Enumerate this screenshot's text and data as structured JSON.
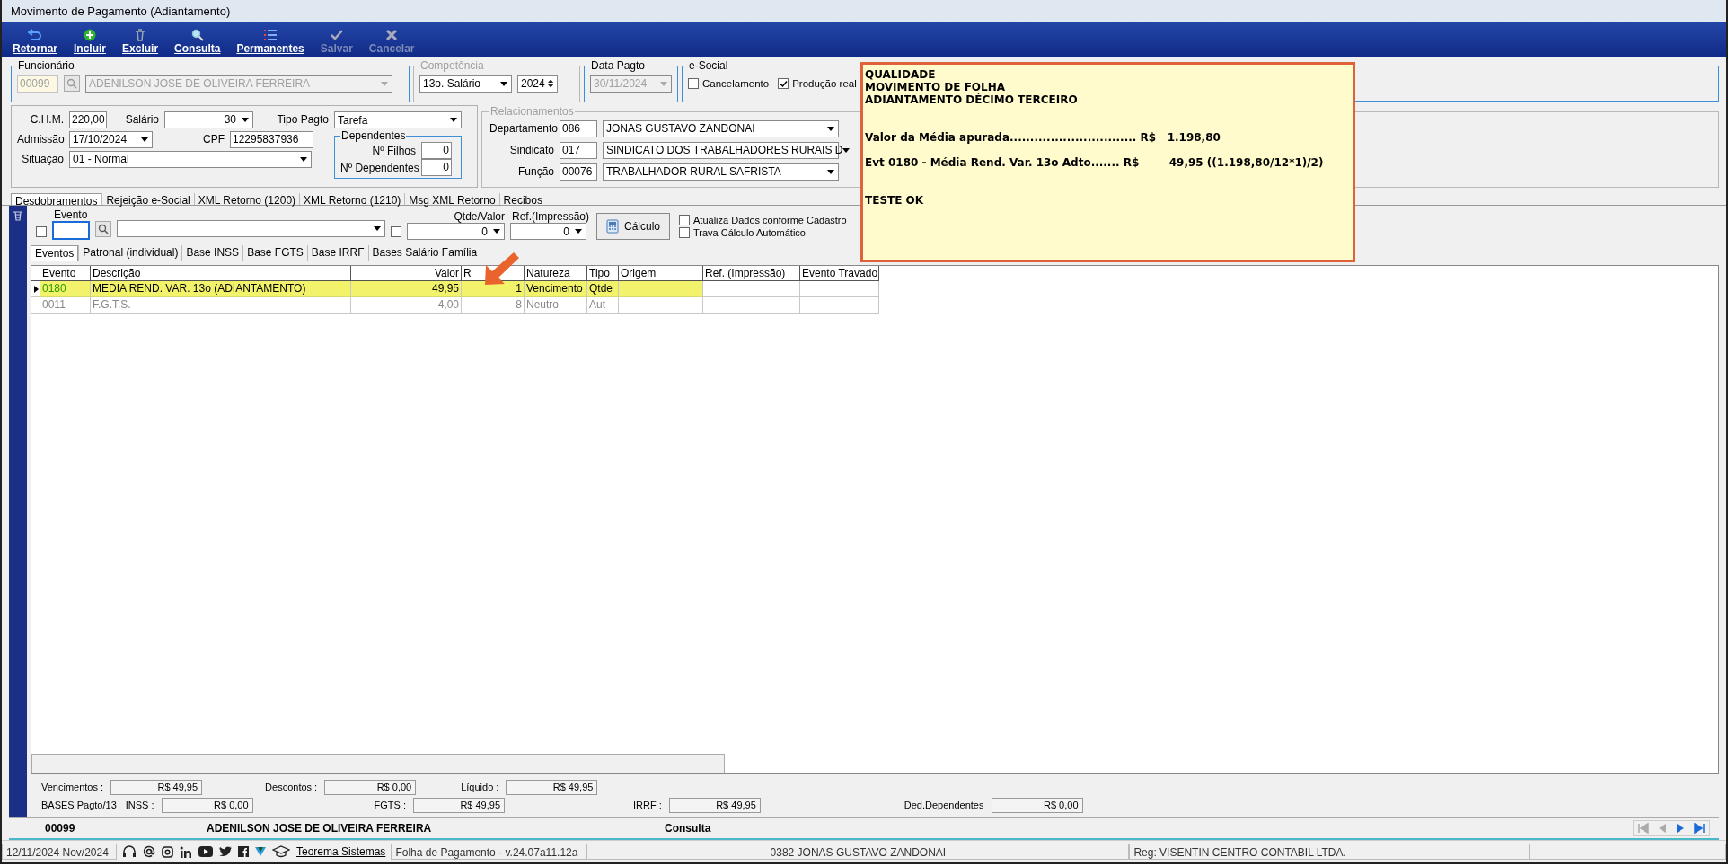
{
  "window": {
    "title": "Movimento de Pagamento (Adiantamento)"
  },
  "toolbar": [
    {
      "label": "Retornar",
      "kind": "back",
      "disabled": false
    },
    {
      "label": "Incluir",
      "kind": "add",
      "disabled": false
    },
    {
      "label": "Excluir",
      "kind": "delete",
      "disabled": false
    },
    {
      "label": "Consulta",
      "kind": "search",
      "disabled": false
    },
    {
      "label": "Permanentes",
      "kind": "list",
      "disabled": false
    },
    {
      "label": "Salvar",
      "kind": "check",
      "disabled": true
    },
    {
      "label": "Cancelar",
      "kind": "cancel",
      "disabled": true
    }
  ],
  "funcionario": {
    "legend": "Funcionário",
    "code": "00099",
    "name": "ADENILSON JOSE DE OLIVEIRA FERREIRA",
    "disabled": true
  },
  "competencia": {
    "legend": "Competência",
    "type": "13o. Salário",
    "year": "2024"
  },
  "data_pagto": {
    "legend": "Data Pagto",
    "date": "30/11/2024"
  },
  "esocial": {
    "legend": "e-Social",
    "options": [
      {
        "label": "Cancelamento",
        "checked": false
      },
      {
        "label": "Produção real",
        "checked": true
      }
    ]
  },
  "contract": {
    "chm": {
      "label": "C.H.M.",
      "value": "220,00"
    },
    "salario": {
      "label": "Salário",
      "value": "30"
    },
    "tipo_pagto": {
      "label": "Tipo Pagto",
      "value": "Tarefa"
    },
    "admissao": {
      "label": "Admissão",
      "value": "17/10/2024"
    },
    "cpf": {
      "label": "CPF",
      "value": "12295837936"
    },
    "situacao": {
      "label": "Situação",
      "value": "01 - Normal"
    },
    "dependentes": {
      "legend": "Dependentes",
      "rows": [
        {
          "label": "Nº Filhos",
          "value": "0"
        },
        {
          "label": "Nº Dependentes",
          "value": "0"
        }
      ]
    }
  },
  "relacionamentos": {
    "legend": "Relacionamentos",
    "rows": [
      {
        "label": "Departamento",
        "code": "086",
        "value": "JONAS GUSTAVO ZANDONAI"
      },
      {
        "label": "Sindicato",
        "code": "017",
        "value": "SINDICATO DOS TRABALHADORES RURAIS D"
      },
      {
        "label": "Função",
        "code": "00076",
        "value": "TRABALHADOR RURAL SAFRISTA"
      }
    ]
  },
  "tabs": [
    {
      "label": "Desdobramentos",
      "selected": true
    },
    {
      "label": "Rejeição e-Social",
      "selected": false
    },
    {
      "label": "XML Retorno (1200)",
      "selected": false
    },
    {
      "label": "XML Retorno (1210)",
      "selected": false
    },
    {
      "label": "Msg XML Retorno",
      "selected": false
    },
    {
      "label": "Recibos",
      "selected": false
    }
  ],
  "filter": {
    "evento_checked": false,
    "qtde_checked": false,
    "evento_label": "Evento",
    "qtde_label": "Qtde/Valor",
    "qtde_value": "0",
    "ref_label": "Ref.(Impressão)",
    "ref_value": "0",
    "calc_button": "Cálculo",
    "options": [
      {
        "label": "Atualiza Dados conforme Cadastro",
        "checked": false
      },
      {
        "label": "Trava Cálculo Automático",
        "checked": false
      }
    ]
  },
  "subtabs": [
    {
      "label": "Eventos",
      "selected": true
    },
    {
      "label": "Patronal (individual)",
      "selected": false
    },
    {
      "label": "Base INSS",
      "selected": false
    },
    {
      "label": "Base FGTS",
      "selected": false
    },
    {
      "label": "Base IRRF",
      "selected": false
    },
    {
      "label": "Bases Salário Família",
      "selected": false
    }
  ],
  "grid": {
    "columns": [
      "Evento",
      "Descrição",
      "Valor",
      "R",
      "Natureza",
      "Tipo",
      "Origem",
      "Ref. (Impressão)",
      "Evento Travado"
    ],
    "rows": [
      {
        "selected": true,
        "evento": "0180",
        "descricao": "MEDIA REND. VAR. 13o (ADIANTAMENTO)",
        "valor": "49,95",
        "ref": "1",
        "natureza": "Vencimento",
        "tipo": "Qtde"
      },
      {
        "selected": false,
        "evento": "0011",
        "descricao": "F.G.T.S.",
        "valor": "4,00",
        "ref": "8",
        "natureza": "Neutro",
        "tipo": "Aut"
      }
    ]
  },
  "totals": [
    {
      "label": "Vencimentos :",
      "value": "R$ 49,95"
    },
    {
      "label": "Descontos :",
      "value": "R$ 0,00"
    },
    {
      "label": "Líquido :",
      "value": "R$ 49,95"
    }
  ],
  "bases": {
    "label": "BASES Pagto/13",
    "items": [
      {
        "label": "INSS :",
        "value": "R$ 0,00"
      },
      {
        "label": "FGTS :",
        "value": "R$ 49,95"
      },
      {
        "label": "IRRF :",
        "value": "R$ 49,95"
      },
      {
        "label": "Ded.Dependentes",
        "value": "R$ 0,00"
      }
    ]
  },
  "record_bar": {
    "code": "00099",
    "name": "ADENILSON JOSE DE OLIVEIRA FERREIRA",
    "mode": "Consulta"
  },
  "status_bar": {
    "date": "12/11/2024 Nov/2024",
    "link": "Teorema Sistemas",
    "version": "Folha de Pagamento - v.24.07a11.12a",
    "user": "0382 JONAS GUSTAVO ZANDONAI",
    "reg": "Reg: VISENTIN CENTRO CONTABIL LTDA."
  },
  "note": {
    "paragraphs": [
      [
        "QUALIDADE",
        "MOVIMENTO DE FOLHA",
        "ADIANTAMENTO DÉCIMO TERCEIRO"
      ],
      [
        "Valor da Média apurada............................... R$   1.198,80"
      ],
      [
        "Evt 0180 - Média Rend. Var. 13o Adto....... R$        49,95 ((1.198,80/12*1)/2)"
      ],
      [
        "TESTE OK"
      ]
    ]
  }
}
